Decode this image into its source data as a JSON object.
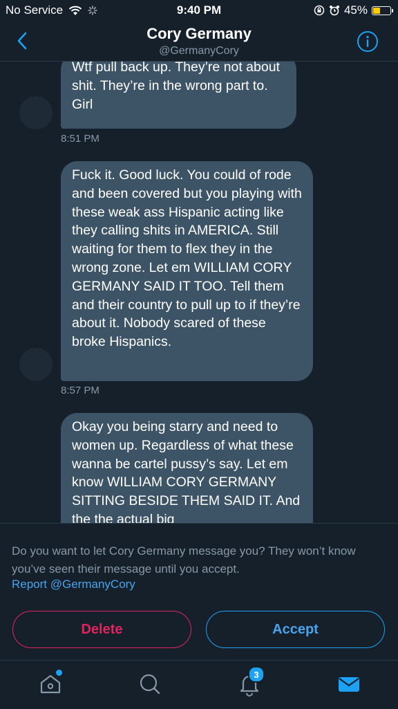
{
  "status_bar": {
    "carrier": "No Service",
    "time": "9:40 PM",
    "battery_percent": "45%",
    "battery_level": 0.45,
    "battery_color": "#ffcc00"
  },
  "header": {
    "title": "Cory Germany",
    "handle": "@GermanyCory",
    "back_icon": "chevron-left-icon",
    "info_icon": "info-icon"
  },
  "messages": [
    {
      "text": "Wtf pull back up. They’re not about shit. They’re in the wrong part to. Girl",
      "time": "8:51 PM"
    },
    {
      "text": "Fuck it. Good luck. You could of rode and been covered but you playing with these weak ass Hispanic acting like they calling shits in AMERICA.  Still waiting for them to flex they in the wrong zone. Let em WILLIAM CORY GERMANY SAID IT TOO. Tell them and their country to pull up to if they’re about it. Nobody scared of these broke Hispanics.",
      "time": "8:57 PM"
    },
    {
      "text": "Okay you being starry and need to women up. Regardless of what these wanna be cartel pussy’s say. Let em know WILLIAM CORY GERMANY SITTING BESIDE THEM SAID IT.  And the the actual big"
    }
  ],
  "request": {
    "prompt": "Do you want to let Cory Germany message you? They won’t know you’ve seen their message until you accept.",
    "report_label": "Report @GermanyCory",
    "delete_label": "Delete",
    "accept_label": "Accept"
  },
  "tabbar": {
    "items": [
      {
        "icon": "home-icon",
        "has_dot": true
      },
      {
        "icon": "search-icon"
      },
      {
        "icon": "bell-icon",
        "badge": "3"
      },
      {
        "icon": "mail-icon",
        "active": true
      }
    ]
  },
  "colors": {
    "background": "#15202b",
    "bubble": "#3d5466",
    "accent": "#1da1f2",
    "delete": "#e0245e",
    "muted": "#8899a6"
  }
}
